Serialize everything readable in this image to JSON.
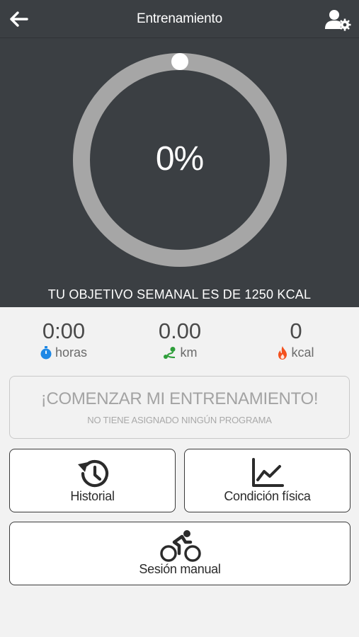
{
  "header": {
    "title": "Entrenamiento"
  },
  "progress": {
    "percent_label": "0%",
    "value": 0
  },
  "goal": {
    "text": "TU OBJETIVO SEMANAL ES DE 1250 KCAL"
  },
  "stats": {
    "hours": {
      "value": "0:00",
      "unit": "horas"
    },
    "distance": {
      "value": "0.00",
      "unit": "km"
    },
    "calories": {
      "value": "0",
      "unit": "kcal"
    }
  },
  "start": {
    "title": "¡COMENZAR MI ENTRENAMIENTO!",
    "subtitle": "NO TIENE ASIGNADO NINGÚN PROGRAMA"
  },
  "tiles": {
    "history": "Historial",
    "fitness": "Condición física",
    "manual": "Sesión manual"
  },
  "colors": {
    "header_bg": "#3b3f43",
    "ring": "#a6a6a6",
    "hours_icon": "#1e88e5",
    "distance_icon": "#2e9e3a",
    "calories_icon": "#f4511e"
  }
}
